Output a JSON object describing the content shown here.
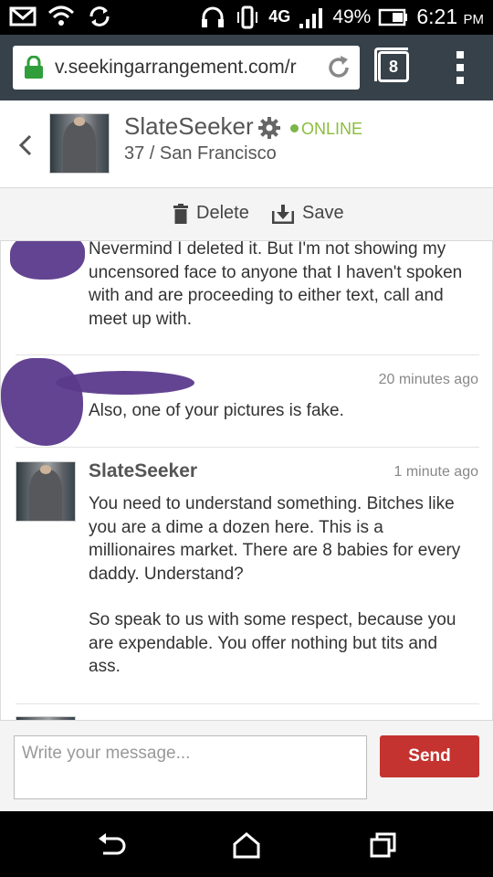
{
  "status_bar": {
    "network": "4G",
    "battery": "49%",
    "time": "6:21",
    "ampm": "PM"
  },
  "browser": {
    "url": "v.seekingarrangement.com/r",
    "tab_count": "8"
  },
  "profile": {
    "username": "SlateSeeker",
    "status": "ONLINE",
    "info": "37 / San Francisco"
  },
  "actions": {
    "delete_label": "Delete",
    "save_label": "Save"
  },
  "messages": [
    {
      "text": "Nevermind I deleted it. But I'm not showing my uncensored face to anyone that I haven't spoken with and are proceeding to either text, call and meet up with."
    },
    {
      "time": "20 minutes ago",
      "text": "Also, one of your pictures is fake."
    },
    {
      "sender": "SlateSeeker",
      "time": "1 minute ago",
      "text_paragraphs": [
        "You need to understand something. Bitches like you are a dime a dozen here. This is a millionaires market. There are 8 babies for every daddy. Understand?",
        "So speak to us with some respect, because you are expendable. You offer nothing but tits and ass."
      ]
    }
  ],
  "composer": {
    "placeholder": "Write your message...",
    "send_label": "Send"
  },
  "colors": {
    "online_green": "#8bbd3f",
    "send_red": "#c4332f",
    "browser_bar": "#37414a",
    "redaction_purple": "#5b3a8c"
  }
}
